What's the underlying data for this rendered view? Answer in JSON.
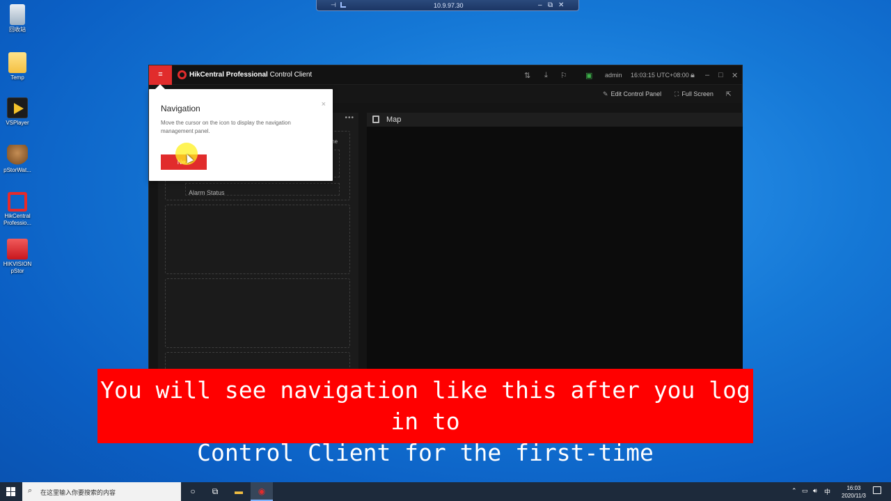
{
  "remote_session": {
    "host": "10.9.97.30",
    "minimize": "–",
    "restore": "⧉",
    "close": "✕"
  },
  "desktop_icons": [
    {
      "label": "回收站",
      "icon": "recycle-bin-icon"
    },
    {
      "label": "Temp",
      "icon": "folder-icon"
    },
    {
      "label": "VSPlayer",
      "icon": "vsplayer-icon"
    },
    {
      "label": "pStorWat...",
      "icon": "pstor-watchdog-icon"
    },
    {
      "label": "HikCentral Professio...",
      "icon": "hikcentral-icon"
    },
    {
      "label": "HIKVISION pStor",
      "icon": "hikvision-pstor-icon"
    }
  ],
  "app": {
    "menu_glyph": "≡",
    "brand_bold": "HikCentral Professional",
    "brand_light": "Control Client",
    "user": "admin",
    "time": "16:03:15 UTC+08:00",
    "toolbar": {
      "edit_control_panel": "Edit Control Panel",
      "full_screen": "Full Screen"
    },
    "left_panel": {
      "more_glyph": "•••",
      "alarm_status": "Alarm Status",
      "partial_label": "me"
    },
    "map_panel": {
      "title": "Map"
    }
  },
  "popup": {
    "title": "Navigation",
    "close_glyph": "×",
    "description": "Move the cursor on the icon to display the navigation management panel.",
    "next_label": "Next"
  },
  "caption": {
    "line1": "You will see navigation like this after you log in to",
    "line2": "Control Client for the first-time"
  },
  "taskbar": {
    "search_placeholder": "在这里输入你要搜索的内容",
    "ime": "中",
    "time": "16:03",
    "date": "2020/11/3"
  },
  "colors": {
    "accent_red": "#e12c2c",
    "caption_red": "#ff0000"
  }
}
